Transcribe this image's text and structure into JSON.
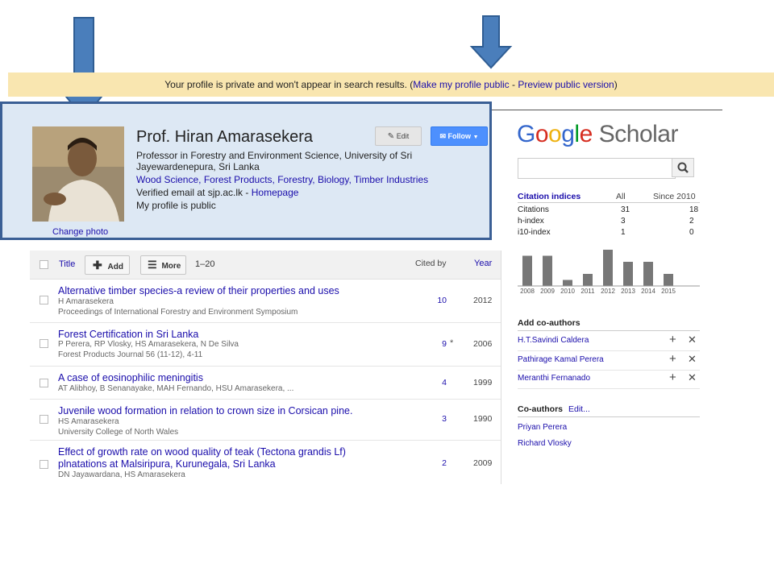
{
  "banner": {
    "text": "Your profile is private and won't appear in search results.",
    "open": " (",
    "link1": "Make my profile public",
    "sep": " - ",
    "link2": "Preview public version",
    "close": ")"
  },
  "profile": {
    "name": "Prof. Hiran Amarasekera",
    "affiliation": "Professor in Forestry and Environment Science, University of Sri Jayewardenepura, Sri Lanka",
    "interests": "Wood Science, Forest Products, Forestry, Biology, Timber Industries",
    "verified": "Verified email at sjp.ac.lk - ",
    "homepage": "Homepage",
    "public_status": "My profile is public",
    "change_photo": "Change photo",
    "edit_label": "Edit",
    "follow_label": "Follow"
  },
  "table": {
    "title_header": "Title",
    "add_label": "Add",
    "more_label": "More",
    "range": "1–20",
    "cited_by_header": "Cited by",
    "year_header": "Year",
    "rows": [
      {
        "title": "Alternative timber species-a review of their properties and uses",
        "authors": "H Amarasekera",
        "venue": "Proceedings of International Forestry and Environment Symposium",
        "cites": "10",
        "star": "",
        "year": "2012"
      },
      {
        "title": "Forest Certification in Sri Lanka",
        "authors": "P Perera, RP Vlosky, HS Amarasekera, N De Silva",
        "venue": "Forest Products Journal 56 (11-12), 4-11",
        "cites": "9",
        "star": "*",
        "year": "2006"
      },
      {
        "title": "A case of eosinophilic meningitis",
        "authors": "AT Alibhoy, B Senanayake, MAH Fernando, HSU Amarasekera, ...",
        "venue": "",
        "cites": "4",
        "star": "",
        "year": "1999"
      },
      {
        "title": "Juvenile wood formation in relation to crown size in Corsican pine.",
        "authors": "HS Amarasekera",
        "venue": "University College of North Wales",
        "cites": "3",
        "star": "",
        "year": "1990"
      },
      {
        "title": "Effect of growth rate on wood quality of teak (Tectona grandis Lf) plnatations at Malsiripura, Kurunegala, Sri Lanka",
        "authors": "DN Jayawardana, HS Amarasekera",
        "venue": "",
        "cites": "2",
        "star": "",
        "year": "2009"
      }
    ]
  },
  "sidebar": {
    "logo_google": "Google",
    "logo_scholar": "Scholar",
    "search_placeholder": "",
    "citation_header": "Citation indices",
    "col_all": "All",
    "col_since": "Since 2010",
    "indices": [
      {
        "label": "Citations",
        "all": "31",
        "since": "18"
      },
      {
        "label": "h-index",
        "all": "3",
        "since": "2"
      },
      {
        "label": "i10-index",
        "all": "1",
        "since": "0"
      }
    ],
    "add_coauthors_header": "Add co-authors",
    "suggested": [
      "H.T.Savindi Caldera",
      "Pathirage Kamal Perera",
      "Meranthi Fernanado"
    ],
    "coauthors_header": "Co-authors",
    "coauthors_edit": "Edit...",
    "coauthors": [
      "Priyan Perera",
      "Richard Vlosky"
    ]
  },
  "chart_data": {
    "type": "bar",
    "categories": [
      "2008",
      "2009",
      "2010",
      "2011",
      "2012",
      "2013",
      "2014",
      "2015"
    ],
    "values": [
      5,
      5,
      1,
      2,
      6,
      4,
      4,
      2
    ],
    "bar_color": "#777777"
  },
  "colors": {
    "banner_bg": "#f9e6b0",
    "profile_bg": "#dde8f4",
    "profile_border": "#3a5f95",
    "link": "#1a0dab",
    "arrow": "#4a7ebb"
  }
}
